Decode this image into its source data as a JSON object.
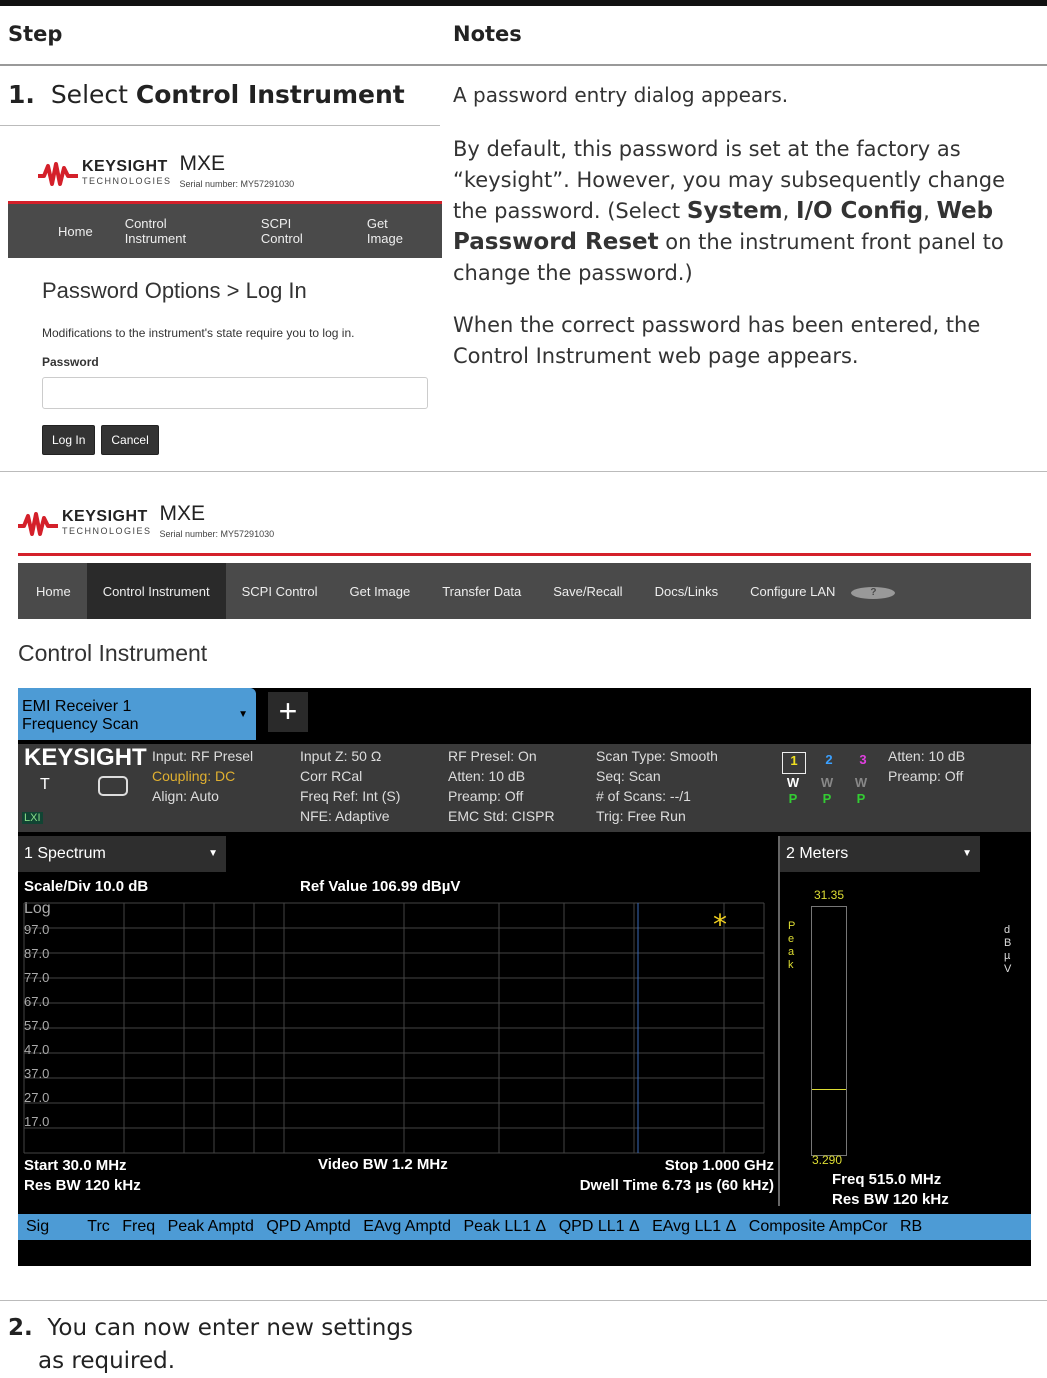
{
  "table": {
    "header_step": "Step",
    "header_notes": "Notes"
  },
  "step1": {
    "number": "1.",
    "prefix": "Select ",
    "bold": "Control Instrument",
    "note1": "A password entry dialog appears.",
    "note2_a": "By default, this password is set at the factory as “keysight”. However, you may subsequently change the password. (Select ",
    "note2_b1": "System",
    "note2_sep1": ", ",
    "note2_b2": "I/O Config",
    "note2_sep2": ", ",
    "note2_b3": "Web Password Reset",
    "note2_c": " on the instrument front panel to change the password.)",
    "note3": "When the correct password has been entered, the Control Instrument web page appears."
  },
  "step2": {
    "number": "2.",
    "text_line1": "You can now enter new settings",
    "text_line2": "as required."
  },
  "brand": {
    "name": "KEYSIGHT",
    "sub": "TECHNOLOGIES",
    "model": "MXE",
    "serial": "Serial number: MY57291030",
    "accent": "#d4202a"
  },
  "login": {
    "nav": [
      "Home",
      "Control Instrument",
      "SCPI Control",
      "Get Image"
    ],
    "title": "Password Options > Log In",
    "message": "Modifications to the instrument's state require you to log in.",
    "password_label": "Password",
    "password_value": "",
    "login_button": "Log In",
    "cancel_button": "Cancel"
  },
  "webpage": {
    "nav": [
      "Home",
      "Control Instrument",
      "SCPI Control",
      "Get Image",
      "Transfer Data",
      "Save/Recall",
      "Docs/Links",
      "Configure LAN"
    ],
    "help_icon": "help-icon",
    "page_title": "Control Instrument"
  },
  "instrument": {
    "mode_tab_line1": "EMI Receiver 1",
    "mode_tab_line2": "Frequency Scan",
    "add_tab": "+",
    "logo": "KEYSIGHT",
    "t_label": "T",
    "lxi": "LXI",
    "info_col1": [
      "Input: RF Presel",
      "Coupling: DC",
      "Align: Auto"
    ],
    "info_col2": [
      "Input Z: 50 Ω",
      "Corr RCal",
      "Freq Ref: Int (S)",
      "NFE: Adaptive"
    ],
    "info_col3": [
      "RF Presel: On",
      "Atten: 10 dB",
      "Preamp: Off",
      "EMC Std: CISPR"
    ],
    "info_col4": [
      "Scan Type: Smooth",
      "Seq: Scan",
      "# of Scans: --/1",
      "Trig: Free Run"
    ],
    "traces": [
      "1",
      "2",
      "3"
    ],
    "trace_w": [
      "W",
      "W",
      "W"
    ],
    "trace_p": [
      "P",
      "P",
      "P"
    ],
    "trace_colors": [
      "#f0e020",
      "#3aa0ff",
      "#e040e0"
    ],
    "info_col5": [
      "Atten: 10 dB",
      "Preamp: Off"
    ],
    "window1_title": "1 Spectrum",
    "window2_title": "2 Meters",
    "scale": "Scale/Div 10.0 dB",
    "ref_value": "Ref Value 106.99 dBµV",
    "log": "Log",
    "y_ticks": [
      "97.0",
      "87.0",
      "77.0",
      "67.0",
      "57.0",
      "47.0",
      "37.0",
      "27.0",
      "17.0"
    ],
    "start": "Start 30.0 MHz",
    "res_bw": "Res BW 120 kHz",
    "video_bw": "Video BW 1.2 MHz",
    "stop": "Stop 1.000 GHz",
    "dwell": "Dwell Time 6.73 µs (60 kHz)",
    "meter_top": "31.35",
    "meter_bottom": "3.290",
    "meter_label": [
      "P",
      "e",
      "a",
      "k"
    ],
    "meter_unit": [
      "d",
      "B",
      "µ",
      "V"
    ],
    "meter_freq": "Freq 515.0 MHz",
    "meter_rbw": "Res BW 120 kHz",
    "table_columns": [
      "Sig",
      "Trc",
      "Freq",
      "Peak Amptd",
      "QPD Amptd",
      "EAvg Amptd",
      "Peak LL1 Δ",
      "QPD LL1 Δ",
      "EAvg LL1 Δ",
      "Composite AmpCor",
      "RB"
    ]
  }
}
